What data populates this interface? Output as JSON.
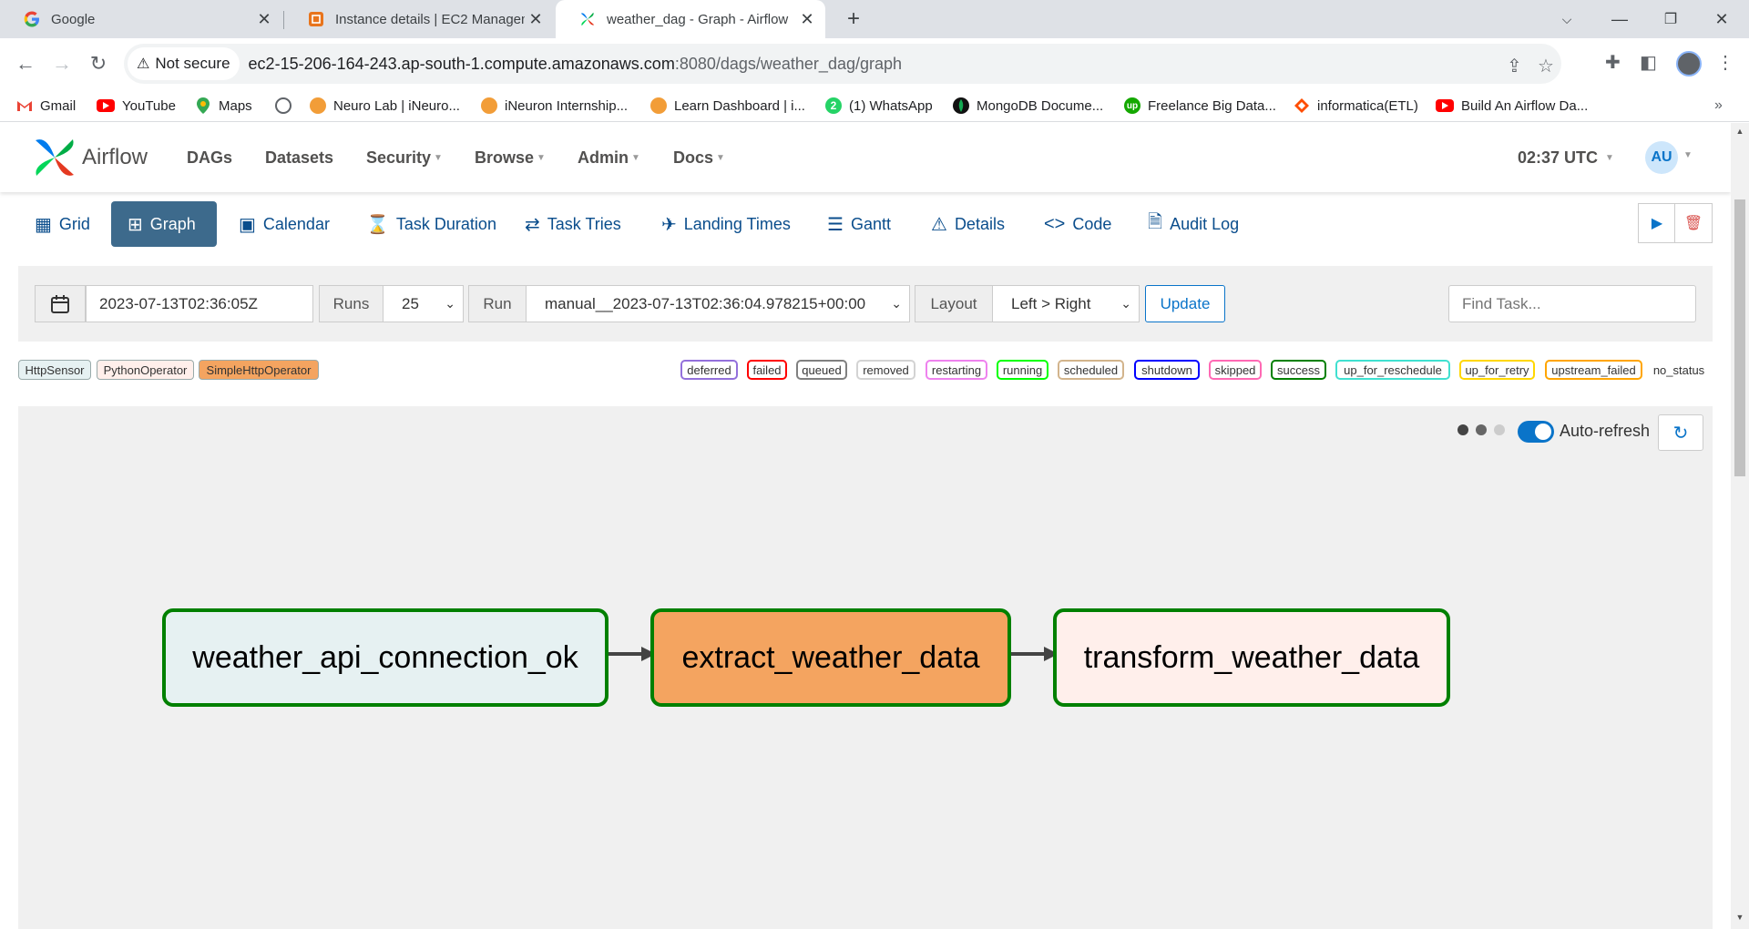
{
  "browser": {
    "tabs": [
      {
        "title": "Google",
        "icon": "google-icon"
      },
      {
        "title": "Instance details | EC2 Manageme",
        "icon": "aws-icon"
      },
      {
        "title": "weather_dag - Graph - Airflow",
        "icon": "airflow-icon",
        "active": true
      }
    ],
    "security_label": "Not secure",
    "url_host": "ec2-15-206-164-243.ap-south-1.compute.amazonaws.com",
    "url_path": ":8080/dags/weather_dag/graph",
    "bookmarks": [
      {
        "label": "Gmail",
        "color": "#ea4335"
      },
      {
        "label": "YouTube",
        "color": "#ff0000"
      },
      {
        "label": "Maps",
        "color": "#34a853"
      },
      {
        "label": "",
        "color": "#5f6368"
      },
      {
        "label": "Neuro Lab | iNeuro...",
        "color": "#f29d38"
      },
      {
        "label": "iNeuron Internship...",
        "color": "#f29d38"
      },
      {
        "label": "Learn Dashboard | i...",
        "color": "#f29d38"
      },
      {
        "label": "(1) WhatsApp",
        "color": "#25d366"
      },
      {
        "label": "MongoDB Docume...",
        "color": "#13aa52"
      },
      {
        "label": "Freelance Big Data...",
        "color": "#14a800"
      },
      {
        "label": "informatica(ETL)",
        "color": "#ff4d00"
      },
      {
        "label": "Build An Airflow Da...",
        "color": "#ff0000"
      }
    ],
    "bookmark_glyphs": {
      "whatsapp": "2",
      "upwork": "up"
    }
  },
  "airflow": {
    "brand": "Airflow",
    "menu": [
      {
        "label": "DAGs",
        "dropdown": false
      },
      {
        "label": "Datasets",
        "dropdown": false
      },
      {
        "label": "Security",
        "dropdown": true
      },
      {
        "label": "Browse",
        "dropdown": true
      },
      {
        "label": "Admin",
        "dropdown": true
      },
      {
        "label": "Docs",
        "dropdown": true
      }
    ],
    "clock": "02:37 UTC",
    "user_initials": "AU",
    "view_tabs": [
      {
        "label": "Grid",
        "icon": "grid-icon"
      },
      {
        "label": "Graph",
        "icon": "graph-icon",
        "active": true
      },
      {
        "label": "Calendar",
        "icon": "calendar-icon"
      },
      {
        "label": "Task Duration",
        "icon": "hourglass-icon"
      },
      {
        "label": "Task Tries",
        "icon": "repeat-icon"
      },
      {
        "label": "Landing Times",
        "icon": "plane-landing-icon"
      },
      {
        "label": "Gantt",
        "icon": "gantt-icon"
      },
      {
        "label": "Details",
        "icon": "warning-triangle-icon"
      },
      {
        "label": "Code",
        "icon": "code-icon"
      },
      {
        "label": "Audit Log",
        "icon": "file-search-icon"
      }
    ],
    "controls": {
      "execution_date": "2023-07-13T02:36:05Z",
      "runs_label": "Runs",
      "runs_value": "25",
      "run_label": "Run",
      "run_value": "manual__2023-07-13T02:36:04.978215+00:00",
      "layout_label": "Layout",
      "layout_value": "Left > Right",
      "update_label": "Update",
      "find_placeholder": "Find Task..."
    },
    "operators": [
      {
        "label": "HttpSensor",
        "color": "#e6f1f2"
      },
      {
        "label": "PythonOperator",
        "color": "#ffefeb"
      },
      {
        "label": "SimpleHttpOperator",
        "color": "#f4a460"
      }
    ],
    "states": [
      {
        "label": "deferred",
        "color": "#9370db"
      },
      {
        "label": "failed",
        "color": "#ff0000"
      },
      {
        "label": "queued",
        "color": "#808080"
      },
      {
        "label": "removed",
        "color": "#d3d3d3"
      },
      {
        "label": "restarting",
        "color": "#ee82ee"
      },
      {
        "label": "running",
        "color": "#00ff00"
      },
      {
        "label": "scheduled",
        "color": "#d2b48c"
      },
      {
        "label": "shutdown",
        "color": "#0000ff"
      },
      {
        "label": "skipped",
        "color": "#ff69b4"
      },
      {
        "label": "success",
        "color": "#008000"
      },
      {
        "label": "up_for_reschedule",
        "color": "#40e0d0"
      },
      {
        "label": "up_for_retry",
        "color": "#ffd700"
      },
      {
        "label": "upstream_failed",
        "color": "#ffa500"
      },
      {
        "label": "no_status",
        "color": ""
      }
    ],
    "auto_refresh_label": "Auto-refresh",
    "auto_refresh_on": true,
    "tasks": [
      {
        "id": "weather_api_connection_ok",
        "fill": "#e6f1f2",
        "state_color": "#008000"
      },
      {
        "id": "extract_weather_data",
        "fill": "#f4a460",
        "state_color": "#008000"
      },
      {
        "id": "transform_weather_data",
        "fill": "#ffefeb",
        "state_color": "#008000"
      }
    ]
  }
}
